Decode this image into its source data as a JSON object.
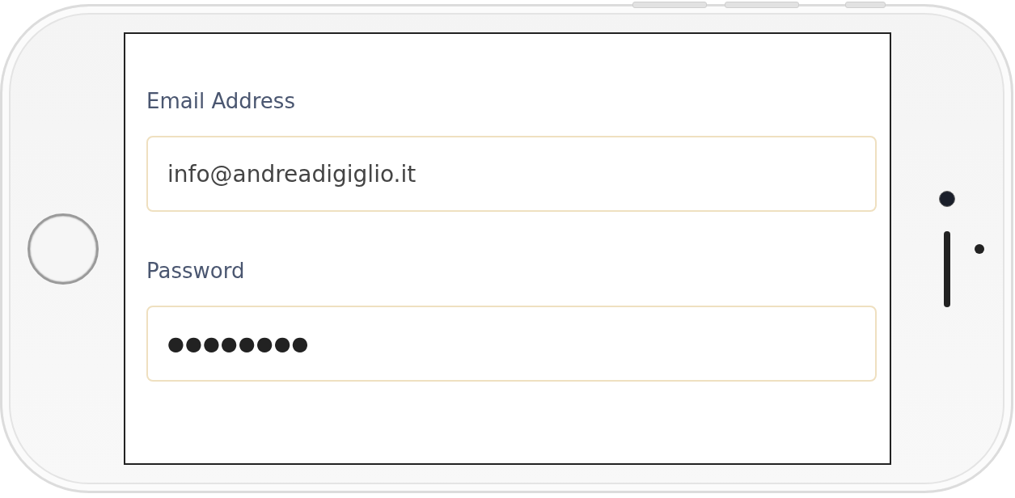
{
  "form": {
    "fields": [
      {
        "kind": "text",
        "label": "Email Address",
        "value": "info@andreadigiglio.it"
      },
      {
        "kind": "password",
        "label": "Password",
        "value": "●●●●●●●●"
      }
    ]
  }
}
